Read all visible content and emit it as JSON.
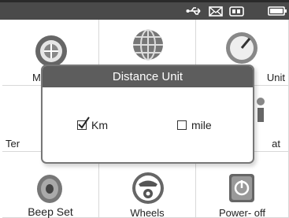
{
  "status_bar": {
    "icons": [
      "usb-icon",
      "mail-icon",
      "battery-pack-icon",
      "battery-icon"
    ]
  },
  "grid": {
    "row1": [
      {
        "label": "M",
        "icon": "globe-network-icon"
      },
      {
        "label": "",
        "icon": "globe-icon"
      },
      {
        "label": "Unit",
        "icon": "gauge-icon"
      }
    ],
    "row2": [
      {
        "label": "Ter",
        "icon": ""
      },
      {
        "label": "",
        "icon": ""
      },
      {
        "label": "at",
        "icon": "device-icon"
      }
    ],
    "row3": [
      {
        "label": "Beep Set",
        "icon": "speaker-icon"
      },
      {
        "label": "Wheels",
        "icon": "wheels-icon"
      },
      {
        "label": "Power- off",
        "icon": "power-icon"
      }
    ]
  },
  "dialog": {
    "title": "Distance Unit",
    "options": [
      {
        "label": "Km",
        "checked": true
      },
      {
        "label": "mile",
        "checked": false
      }
    ]
  }
}
